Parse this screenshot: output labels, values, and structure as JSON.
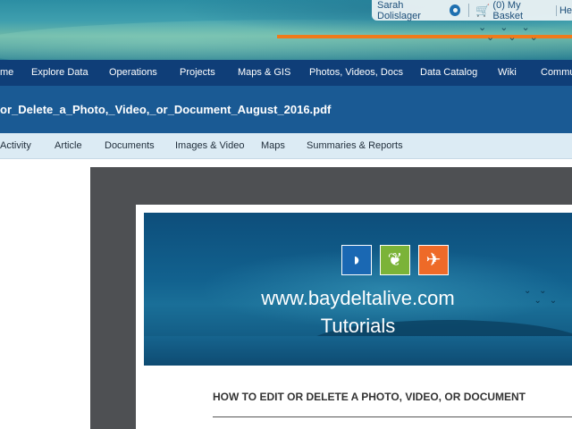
{
  "header": {
    "user_name": "Sarah Dolislager",
    "basket_label": "(0) My Basket",
    "help_label": "He"
  },
  "main_nav": {
    "items": [
      "me",
      "Explore Data",
      "Operations",
      "Projects",
      "Maps & GIS",
      "Photos, Videos, Docs",
      "Data Catalog",
      "Wiki",
      "Commu"
    ]
  },
  "page": {
    "title": "or_Delete_a_Photo,_Video,_or_Document_August_2016.pdf"
  },
  "sub_nav": {
    "items": [
      "Activity",
      "Article",
      "Documents",
      "Images & Video",
      "Maps",
      "Summaries & Reports"
    ]
  },
  "document": {
    "hero_url": "www.baydeltalive.com",
    "hero_subtitle": "Tutorials",
    "heading": "HOW TO EDIT OR DELETE A PHOTO, VIDEO, OR DOCUMENT"
  },
  "colors": {
    "nav_bg": "#0f3e78",
    "title_bg": "#1a5a94",
    "subnav_bg": "#dcebf4",
    "accent_orange": "#f07a1a",
    "logo_blue": "#1a68b3",
    "logo_green": "#7bb338",
    "logo_orange": "#ee6a28"
  },
  "icons": {
    "settings": "gear-icon",
    "basket": "basket-icon",
    "logo_1": "whale-icon",
    "logo_2": "leaf-icon",
    "logo_3": "bird-icon"
  }
}
